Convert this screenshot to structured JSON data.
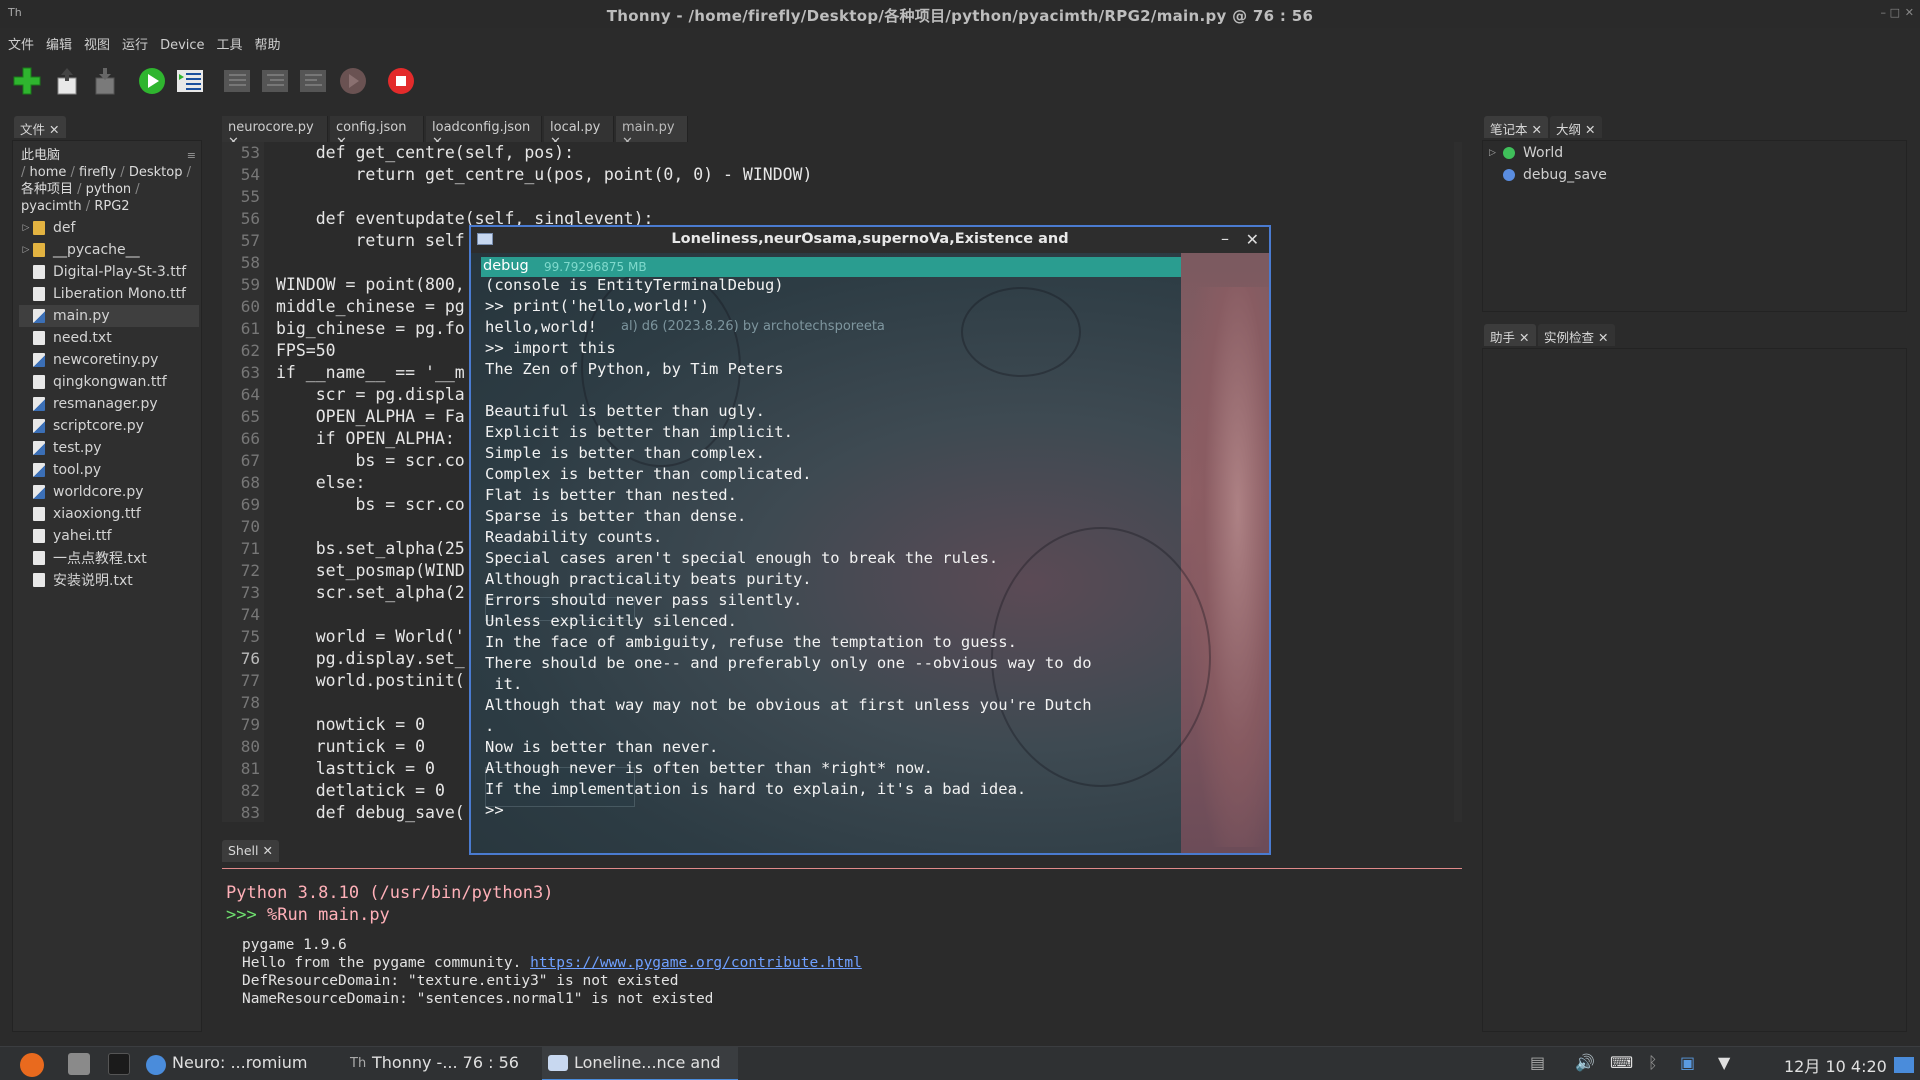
{
  "window": {
    "title": "Thonny  -  /home/firefly/Desktop/各种项目/python/pyacimth/RPG2/main.py  @  76 : 56"
  },
  "menu": [
    "文件",
    "编辑",
    "视图",
    "运行",
    "Device",
    "工具",
    "帮助"
  ],
  "files_panel": {
    "tab_label": "文件",
    "title": "此电脑",
    "breadcrumb": [
      "home",
      "firefly",
      "Desktop",
      "各种项目",
      "python",
      "pyacimth",
      "RPG2"
    ],
    "items": [
      {
        "name": "def",
        "type": "folder"
      },
      {
        "name": "__pycache__",
        "type": "folder"
      },
      {
        "name": "Digital-Play-St-3.ttf",
        "type": "file"
      },
      {
        "name": "Liberation Mono.ttf",
        "type": "file"
      },
      {
        "name": "main.py",
        "type": "py",
        "selected": true
      },
      {
        "name": "need.txt",
        "type": "file"
      },
      {
        "name": "newcoretiny.py",
        "type": "py"
      },
      {
        "name": "qingkongwan.ttf",
        "type": "file"
      },
      {
        "name": "resmanager.py",
        "type": "py"
      },
      {
        "name": "scriptcore.py",
        "type": "py"
      },
      {
        "name": "test.py",
        "type": "py"
      },
      {
        "name": "tool.py",
        "type": "py"
      },
      {
        "name": "worldcore.py",
        "type": "py"
      },
      {
        "name": "xiaoxiong.ttf",
        "type": "file"
      },
      {
        "name": "yahei.ttf",
        "type": "file"
      },
      {
        "name": "一点点教程.txt",
        "type": "file"
      },
      {
        "name": "安装说明.txt",
        "type": "file"
      }
    ]
  },
  "editor": {
    "tabs": [
      "neurocore.py",
      "config.json",
      "loadconfig.json",
      "local.py",
      "main.py"
    ],
    "active_tab": "main.py",
    "line_numbers": [
      "53",
      "54",
      "55",
      "56",
      "57",
      "58",
      "59",
      "60",
      "61",
      "62",
      "63",
      "64",
      "65",
      "66",
      "67",
      "68",
      "69",
      "70",
      "71",
      "72",
      "73",
      "74",
      "75",
      "76",
      "77",
      "78",
      "79",
      "80",
      "81",
      "82",
      "83"
    ],
    "current_line": "76",
    "lines": [
      "    def get_centre(self, pos):",
      "        return get_centre_u(pos, point(0, 0) - WINDOW)",
      "",
      "    def eventupdate(self, singlevent):",
      "        return self",
      "",
      "WINDOW = point(800,",
      "middle_chinese = pg",
      "big_chinese = pg.fo",
      "FPS=50",
      "if __name__ == '__m",
      "    scr = pg.displa",
      "    OPEN_ALPHA = Fa",
      "    if OPEN_ALPHA:",
      "        bs = scr.co",
      "    else:",
      "        bs = scr.co",
      "",
      "    bs.set_alpha(25",
      "    set_posmap(WIND",
      "    scr.set_alpha(2",
      "",
      "    world = World('",
      "    pg.display.set_",
      "    world.postinit(",
      "",
      "    nowtick = 0",
      "    runtick = 0",
      "    lasttick = 0",
      "    detlatick = 0",
      "    def debug_save("
    ]
  },
  "shell": {
    "tab_label": "Shell",
    "python_version": "Python 3.8.10 (/usr/bin/python3)",
    "prompt": ">>>",
    "command": "%Run main.py",
    "output": [
      "pygame 1.9.6",
      "Hello from the pygame community. ",
      "DefResourceDomain: \"texture.entiy3\" is not existed",
      "NameResourceDomain: \"sentences.normal1\" is not existed"
    ],
    "link": "https://www.pygame.org/contribute.html"
  },
  "right_panel_top": {
    "tabs": [
      "笔记本",
      "大纲"
    ],
    "items": [
      "World",
      "debug_save"
    ]
  },
  "right_panel_bottom": {
    "tabs": [
      "助手",
      "实例检查"
    ]
  },
  "popup": {
    "title": "Loneliness,neurOsama,supernoVa,Existence and",
    "debug_label": "debug",
    "memory": "99.79296875 MB",
    "ghost_text": "al) d6 (2023.8.26) by archotechsporeeta",
    "lines": [
      "(console is EntityTerminalDebug)",
      ">> print('hello,world!')",
      "hello,world!",
      ">> import this",
      "The Zen of Python, by Tim Peters",
      "",
      "Beautiful is better than ugly.",
      "Explicit is better than implicit.",
      "Simple is better than complex.",
      "Complex is better than complicated.",
      "Flat is better than nested.",
      "Sparse is better than dense.",
      "Readability counts.",
      "Special cases aren't special enough to break the rules.",
      "Although practicality beats purity.",
      "Errors should never pass silently.",
      "Unless explicitly silenced.",
      "In the face of ambiguity, refuse the temptation to guess.",
      "There should be one-- and preferably only one --obvious way to do",
      " it.",
      "Although that way may not be obvious at first unless you're Dutch",
      ".",
      "Now is better than never.",
      "Although never is often better than *right* now.",
      "If the implementation is hard to explain, it's a bad idea.",
      ">>"
    ]
  },
  "taskbar": {
    "items": [
      "Neuro: ...romium",
      "Thonny -... 76 : 56",
      "Loneline...nce and"
    ],
    "clock": "12月 10 4:20"
  }
}
